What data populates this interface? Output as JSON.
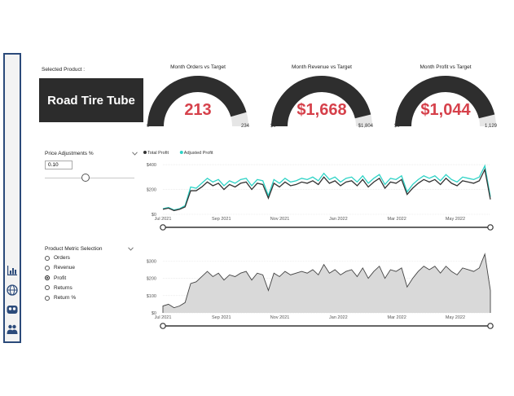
{
  "selected_product_label": "Selected Product :",
  "product_name": "Road Tire Tube",
  "gauges": [
    {
      "title": "Month Orders vs Target",
      "value": "213",
      "min": "0",
      "max": "234",
      "fraction": 0.91
    },
    {
      "title": "Month Revenue vs Target",
      "value": "$1,668",
      "min": "$0",
      "max": "$1,804",
      "fraction": 0.925
    },
    {
      "title": "Month Profit vs Target",
      "value": "$1,044",
      "min": "$0",
      "max": "1,129",
      "fraction": 0.925
    }
  ],
  "price_adjustment": {
    "label": "Price Adjustments %",
    "value": "0.10",
    "slider_fraction": 0.45
  },
  "metric_selection": {
    "label": "Product Metric Selection",
    "options": [
      {
        "label": "Orders",
        "selected": false
      },
      {
        "label": "Revenue",
        "selected": false
      },
      {
        "label": "Profit",
        "selected": true
      },
      {
        "label": "Returns",
        "selected": false
      },
      {
        "label": "Return %",
        "selected": false
      }
    ]
  },
  "colors": {
    "total": "#333333",
    "adjusted": "#2ed3c6",
    "gauge": "#2e2e2e",
    "gauge_bg": "#e6e6e6",
    "value": "#d6414b",
    "sidebar_border": "#2b4a7a"
  },
  "sidebar_icons": [
    "bar-chart-icon",
    "globe-icon",
    "group-icon",
    "people-icon"
  ],
  "chart_data": [
    {
      "type": "line",
      "legend": [
        "Total Profit",
        "Adjusted Profit"
      ],
      "x_ticks": [
        "Jul 2021",
        "Sep 2021",
        "Nov 2021",
        "Jan 2022",
        "Mar 2022",
        "May 2022"
      ],
      "y_ticks": [
        "$0",
        "$200",
        "$400"
      ],
      "ylim": [
        0,
        420
      ],
      "series": [
        {
          "name": "Total Profit",
          "values": [
            40,
            50,
            30,
            40,
            60,
            190,
            190,
            220,
            260,
            230,
            250,
            200,
            240,
            220,
            250,
            260,
            200,
            250,
            240,
            130,
            250,
            220,
            260,
            230,
            240,
            260,
            250,
            270,
            240,
            300,
            250,
            270,
            230,
            260,
            270,
            230,
            280,
            220,
            260,
            290,
            210,
            260,
            250,
            280,
            160,
            210,
            250,
            280,
            260,
            280,
            240,
            290,
            250,
            230,
            270,
            260,
            250,
            270,
            360,
            120
          ]
        },
        {
          "name": "Adjusted Profit",
          "values": [
            45,
            55,
            35,
            45,
            70,
            220,
            210,
            250,
            290,
            260,
            280,
            230,
            270,
            250,
            280,
            290,
            230,
            280,
            270,
            150,
            280,
            250,
            290,
            260,
            270,
            290,
            280,
            300,
            270,
            330,
            280,
            300,
            260,
            290,
            300,
            260,
            310,
            250,
            290,
            320,
            240,
            290,
            280,
            310,
            180,
            240,
            280,
            310,
            290,
            310,
            270,
            320,
            280,
            260,
            300,
            290,
            280,
            300,
            390,
            140
          ]
        }
      ]
    },
    {
      "type": "area",
      "x_ticks": [
        "Jul 2021",
        "Sep 2021",
        "Nov 2021",
        "Jan 2022",
        "Mar 2022",
        "May 2022"
      ],
      "y_ticks": [
        "$0",
        "$100",
        "$200",
        "$300"
      ],
      "ylim": [
        0,
        330
      ],
      "series": [
        {
          "name": "Profit",
          "values": [
            40,
            50,
            30,
            40,
            60,
            170,
            180,
            210,
            240,
            210,
            230,
            190,
            220,
            210,
            230,
            240,
            190,
            230,
            220,
            130,
            230,
            210,
            240,
            220,
            230,
            240,
            230,
            250,
            220,
            280,
            230,
            250,
            220,
            240,
            250,
            210,
            260,
            200,
            240,
            270,
            200,
            250,
            240,
            260,
            150,
            200,
            240,
            270,
            250,
            270,
            230,
            270,
            240,
            220,
            260,
            250,
            240,
            260,
            340,
            130
          ]
        }
      ]
    }
  ]
}
